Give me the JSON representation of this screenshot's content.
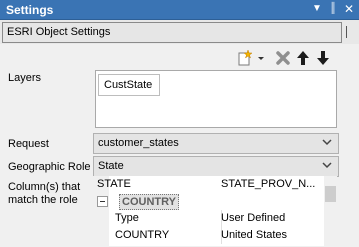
{
  "window": {
    "title": "Settings"
  },
  "object_tab": {
    "label": "ESRI Object Settings"
  },
  "toolbar": {
    "icons": [
      "add-layer-icon",
      "dropdown-arrow-icon",
      "delete-icon",
      "move-up-icon",
      "move-down-icon"
    ]
  },
  "form": {
    "layers_label": "Layers",
    "layers": [
      "CustState"
    ],
    "request_label": "Request",
    "request_value": "customer_states",
    "geo_role_label": "Geographic Role",
    "geo_role_value": "State",
    "columns_label_line1": "Column(s) that",
    "columns_label_line2": "match the role"
  },
  "property_grid": {
    "rows": [
      {
        "name": "STATE",
        "value": "STATE_PROV_N..."
      },
      {
        "group": "COUNTRY"
      },
      {
        "name": "Type",
        "value": "User Defined"
      },
      {
        "name": "COUNTRY",
        "value": "United States"
      }
    ]
  },
  "colors": {
    "titlebar": "#3a74b4",
    "panel_bg": "#f0f0f0"
  }
}
